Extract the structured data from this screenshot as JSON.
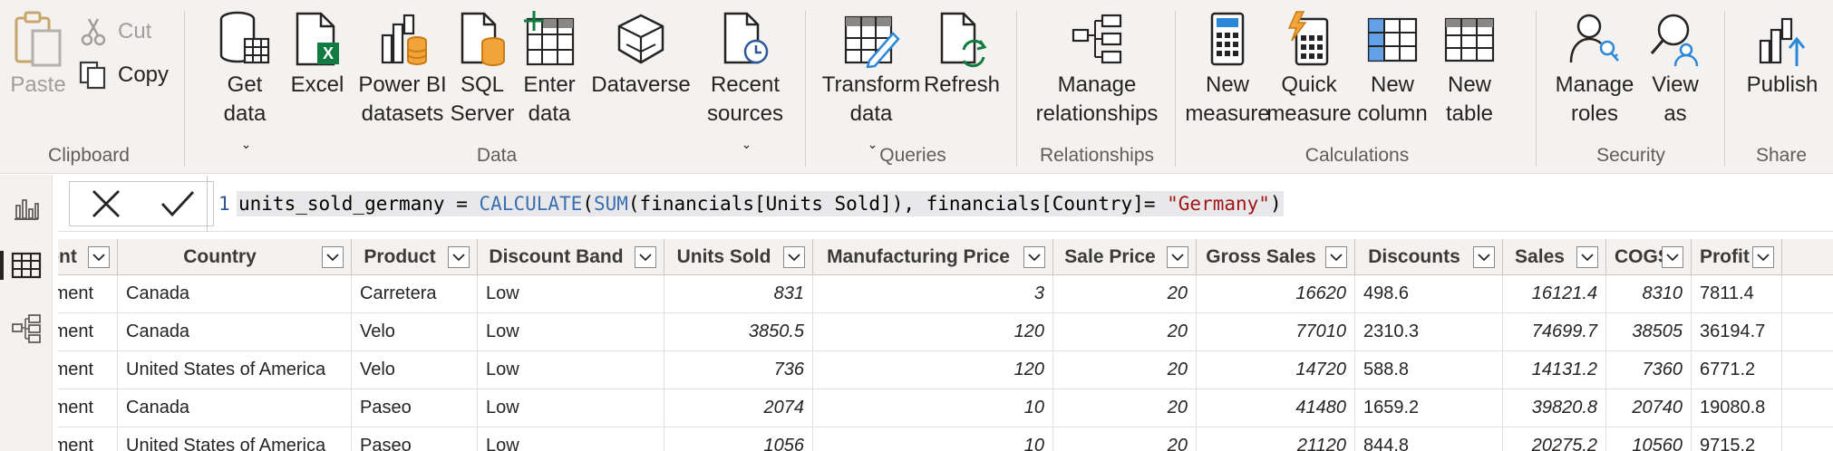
{
  "ribbon": {
    "clipboard": {
      "label": "Clipboard",
      "paste": "Paste",
      "cut": "Cut",
      "copy": "Copy"
    },
    "data": {
      "label": "Data",
      "get_data": [
        "Get",
        "data"
      ],
      "excel": "Excel",
      "power_bi": [
        "Power BI",
        "datasets"
      ],
      "sql": [
        "SQL",
        "Server"
      ],
      "enter": [
        "Enter",
        "data"
      ],
      "dataverse": "Dataverse",
      "recent": [
        "Recent",
        "sources"
      ]
    },
    "queries": {
      "label": "Queries",
      "transform": [
        "Transform",
        "data"
      ],
      "refresh": "Refresh"
    },
    "relationships": {
      "label": "Relationships",
      "manage": [
        "Manage",
        "relationships"
      ]
    },
    "calculations": {
      "label": "Calculations",
      "new_measure": [
        "New",
        "measure"
      ],
      "quick_measure": [
        "Quick",
        "measure"
      ],
      "new_column": [
        "New",
        "column"
      ],
      "new_table": [
        "New",
        "table"
      ]
    },
    "security": {
      "label": "Security",
      "manage_roles": [
        "Manage",
        "roles"
      ],
      "view_as": [
        "View",
        "as"
      ]
    },
    "share": {
      "label": "Share",
      "publish": "Publish"
    }
  },
  "formula": {
    "line": "1",
    "name": "units_sold_germany = ",
    "fn1": "CALCULATE",
    "p1": "(",
    "fn2": "SUM",
    "rest1": "(financials[Units Sold]), financials[Country]= ",
    "str": "\"Germany\"",
    "rest2": ")"
  },
  "table": {
    "columns": [
      "Segment",
      "Country",
      "Product",
      "Discount Band",
      "Units Sold",
      "Manufacturing Price",
      "Sale Price",
      "Gross Sales",
      "Discounts",
      "Sales",
      "COGS",
      "Profit"
    ],
    "rows": [
      [
        "Government",
        "Canada",
        "Carretera",
        "Low",
        "831",
        "3",
        "20",
        "16620",
        "498.6",
        "16121.4",
        "8310",
        "7811.4"
      ],
      [
        "Government",
        "Canada",
        "Velo",
        "Low",
        "3850.5",
        "120",
        "20",
        "77010",
        "2310.3",
        "74699.7",
        "38505",
        "36194.7"
      ],
      [
        "Government",
        "United States of America",
        "Velo",
        "Low",
        "736",
        "120",
        "20",
        "14720",
        "588.8",
        "14131.2",
        "7360",
        "6771.2"
      ],
      [
        "Government",
        "Canada",
        "Paseo",
        "Low",
        "2074",
        "10",
        "20",
        "41480",
        "1659.2",
        "39820.8",
        "20740",
        "19080.8"
      ],
      [
        "Government",
        "United States of America",
        "Paseo",
        "Low",
        "1056",
        "10",
        "20",
        "21120",
        "844.8",
        "20275.2",
        "10560",
        "9715.2"
      ]
    ]
  }
}
